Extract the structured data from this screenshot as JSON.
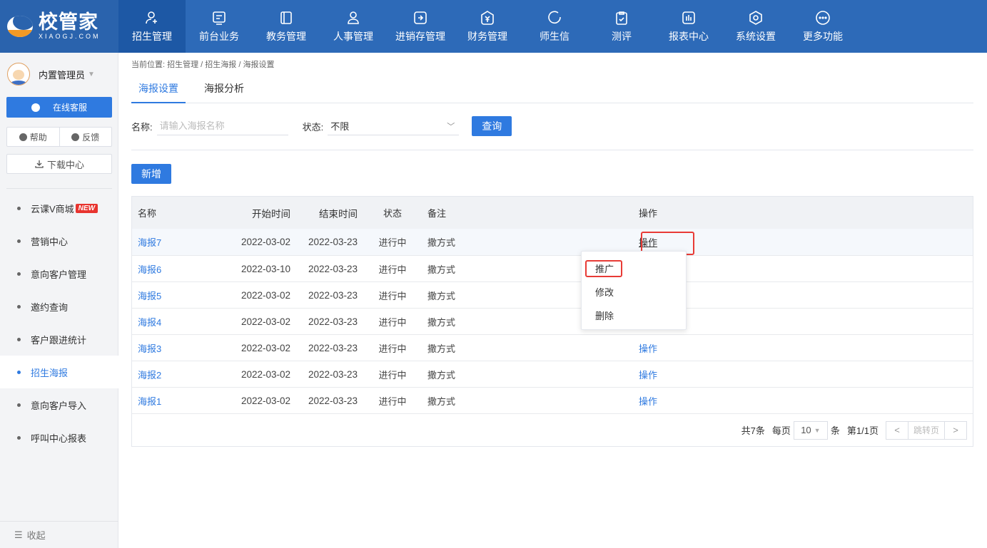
{
  "app": {
    "logo_cn": "校管家",
    "logo_en": "XIAOGJ.COM"
  },
  "nav": [
    {
      "label": "招生管理",
      "icon": "user-add-icon"
    },
    {
      "label": "前台业务",
      "icon": "monitor-icon"
    },
    {
      "label": "教务管理",
      "icon": "book-icon"
    },
    {
      "label": "人事管理",
      "icon": "person-icon"
    },
    {
      "label": "进销存管理",
      "icon": "inventory-icon"
    },
    {
      "label": "财务管理",
      "icon": "yuan-icon"
    },
    {
      "label": "师生信",
      "icon": "chat-icon"
    },
    {
      "label": "测评",
      "icon": "clipboard-check-icon"
    },
    {
      "label": "报表中心",
      "icon": "report-icon"
    },
    {
      "label": "系统设置",
      "icon": "settings-icon"
    },
    {
      "label": "更多功能",
      "icon": "more-icon"
    }
  ],
  "sidebar": {
    "user": "内置管理员",
    "service": "在线客服",
    "help": "帮助",
    "feedback": "反馈",
    "download": "下载中心",
    "menu": [
      {
        "label": "云课V商城",
        "badge": "NEW"
      },
      {
        "label": "营销中心"
      },
      {
        "label": "意向客户管理"
      },
      {
        "label": "邀约查询"
      },
      {
        "label": "客户跟进统计"
      },
      {
        "label": "招生海报"
      },
      {
        "label": "意向客户导入"
      },
      {
        "label": "呼叫中心报表"
      }
    ],
    "collapse": "收起"
  },
  "breadcrumb": "当前位置: 招生管理 / 招生海报 / 海报设置",
  "tabs": [
    "海报设置",
    "海报分析"
  ],
  "filter": {
    "name_label": "名称:",
    "name_placeholder": "请输入海报名称",
    "status_label": "状态:",
    "status_value": "不限",
    "query": "查询"
  },
  "add_button": "新增",
  "table": {
    "headers": [
      "名称",
      "开始时间",
      "结束时间",
      "状态",
      "备注",
      "操作"
    ],
    "rows": [
      {
        "name": "海报7",
        "start": "2022-03-02",
        "end": "2022-03-23",
        "status": "进行中",
        "note": "撒方式",
        "op": "操作"
      },
      {
        "name": "海报6",
        "start": "2022-03-10",
        "end": "2022-03-23",
        "status": "进行中",
        "note": "撒方式",
        "op": ""
      },
      {
        "name": "海报5",
        "start": "2022-03-02",
        "end": "2022-03-23",
        "status": "进行中",
        "note": "撒方式",
        "op": ""
      },
      {
        "name": "海报4",
        "start": "2022-03-02",
        "end": "2022-03-23",
        "status": "进行中",
        "note": "撒方式",
        "op": ""
      },
      {
        "name": "海报3",
        "start": "2022-03-02",
        "end": "2022-03-23",
        "status": "进行中",
        "note": "撒方式",
        "op": "操作"
      },
      {
        "name": "海报2",
        "start": "2022-03-02",
        "end": "2022-03-23",
        "status": "进行中",
        "note": "撒方式",
        "op": "操作"
      },
      {
        "name": "海报1",
        "start": "2022-03-02",
        "end": "2022-03-23",
        "status": "进行中",
        "note": "撒方式",
        "op": "操作"
      }
    ]
  },
  "pagination": {
    "total": "共7条",
    "per_page_label": "每页",
    "per_page": "10",
    "per_page_unit": "条",
    "page_prefix": "第",
    "page_current": "1",
    "page_suffix": "/1页",
    "jump": "跳转页"
  },
  "dropdown": [
    "推广",
    "修改",
    "删除"
  ],
  "colors": {
    "brand": "#2d6ab8",
    "accent": "#2f7ae0",
    "highlight": "#e83b36"
  }
}
